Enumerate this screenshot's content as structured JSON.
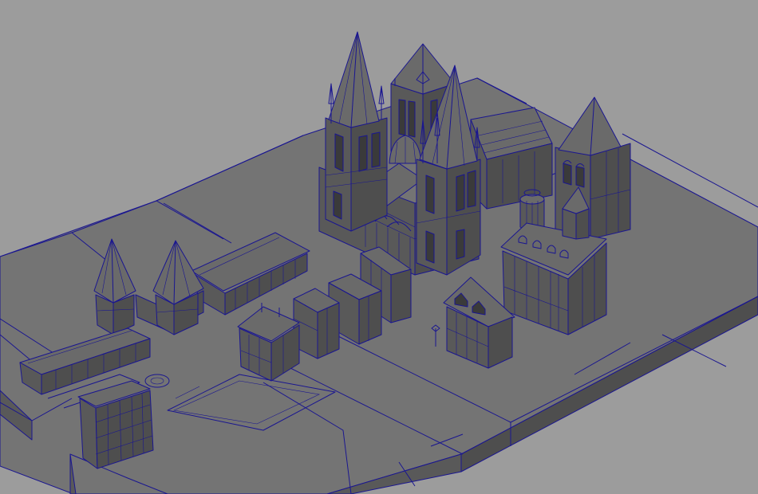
{
  "viewport": {
    "background_color": "#9c9c9c",
    "wireframe_color": "#1a1690",
    "shading": "wireframe-on-shaded"
  },
  "scene": {
    "objects": [
      "ground-plate",
      "cathedral",
      "cathedral-left-spire",
      "cathedral-right-spire",
      "cathedral-back-tower",
      "cathedral-dome",
      "cathedral-nave-vault",
      "right-clock-tower",
      "round-turret",
      "mansard-building",
      "left-twin-pavilions",
      "arcade-colonnade",
      "long-row-building",
      "tall-office-block",
      "corner-townhouse",
      "center-block-buildings",
      "small-gabled-house",
      "fountain-plaza",
      "street-lamp"
    ]
  }
}
